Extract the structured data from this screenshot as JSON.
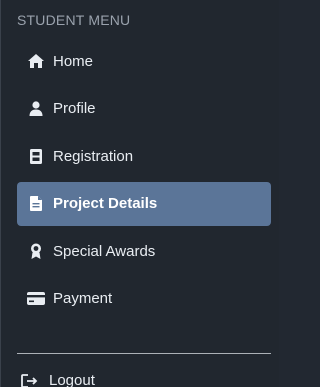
{
  "sidebar": {
    "heading": "STUDENT MENU",
    "items": [
      {
        "label": "Home",
        "icon": "home-icon",
        "active": false
      },
      {
        "label": "Profile",
        "icon": "user-icon",
        "active": false
      },
      {
        "label": "Registration",
        "icon": "id-card-icon",
        "active": false
      },
      {
        "label": "Project Details",
        "icon": "document-icon",
        "active": true
      },
      {
        "label": "Special Awards",
        "icon": "award-icon",
        "active": false
      },
      {
        "label": "Payment",
        "icon": "credit-card-icon",
        "active": false
      }
    ],
    "logout": {
      "label": "Logout",
      "icon": "logout-icon"
    }
  },
  "colors": {
    "background": "#21272f",
    "active_background": "#5b7598",
    "text": "#e9edf2",
    "heading": "#9aa2ad"
  }
}
